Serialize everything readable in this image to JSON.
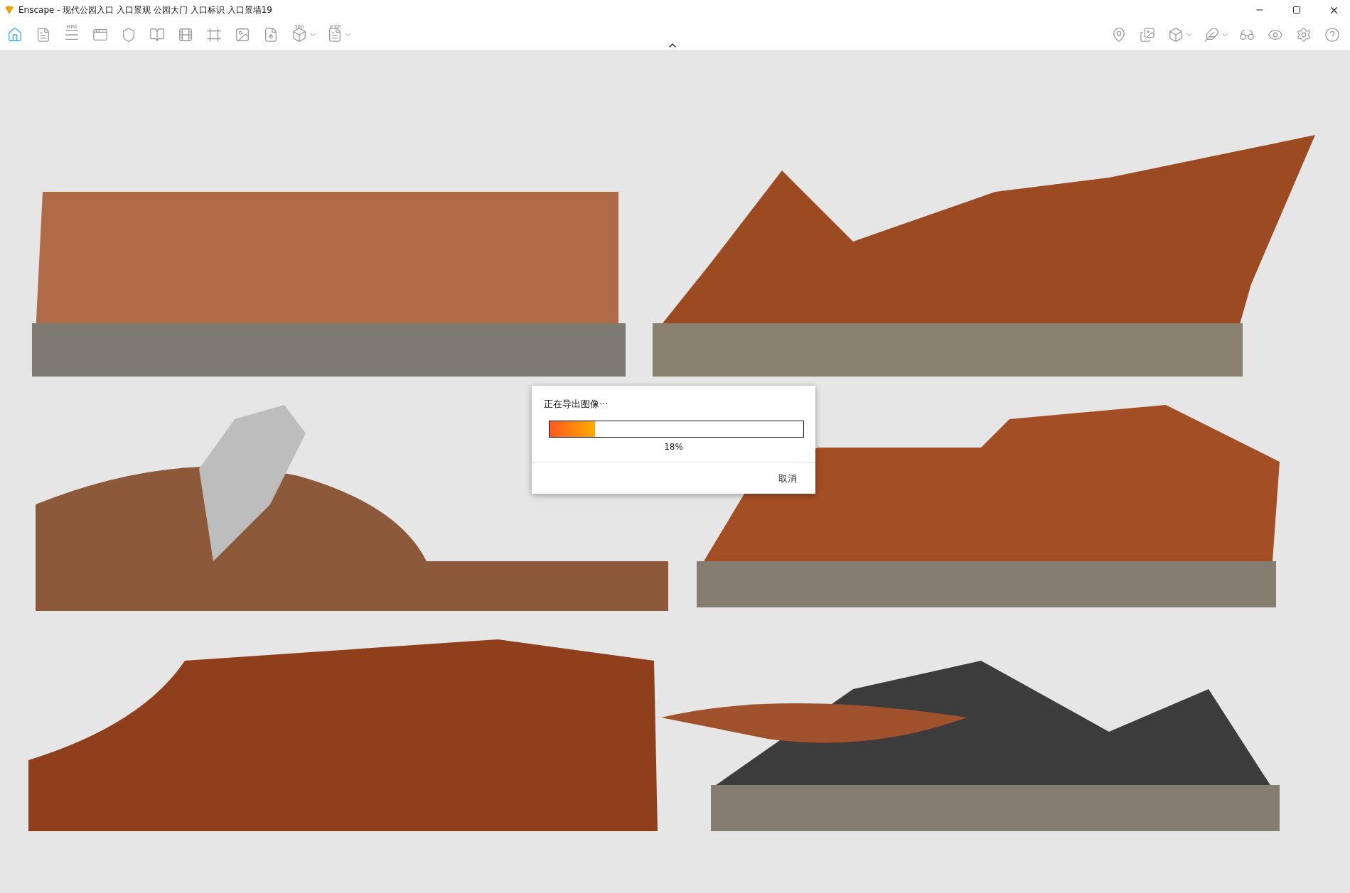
{
  "window": {
    "title": "Enscape - 现代公园入口 入口景观 公园大门 入口标识 入口景墙19"
  },
  "toolbar": {
    "left": [
      {
        "selected": true
      },
      {
        "selected": false
      },
      {
        "selected": false,
        "text": "BIM"
      },
      {
        "selected": false
      },
      {
        "selected": false
      },
      {
        "selected": false
      },
      {
        "selected": false
      },
      {
        "selected": false
      },
      {
        "selected": false
      },
      {
        "selected": false
      },
      {
        "selected": false,
        "text": "360",
        "dropdown": true
      },
      {
        "selected": false,
        "text": "EXE",
        "dropdown": true
      }
    ],
    "right": [
      {
        "selected": false
      },
      {
        "selected": false
      },
      {
        "selected": false,
        "dropdown": true
      },
      {
        "selected": false,
        "dropdown": true
      },
      {
        "selected": false
      },
      {
        "selected": false
      },
      {
        "selected": false
      },
      {
        "selected": false
      }
    ]
  },
  "dialog": {
    "message": "正在导出图像···",
    "progress": {
      "level": 0.18
    },
    "percent": "18%",
    "buttons": [
      "取消"
    ]
  }
}
